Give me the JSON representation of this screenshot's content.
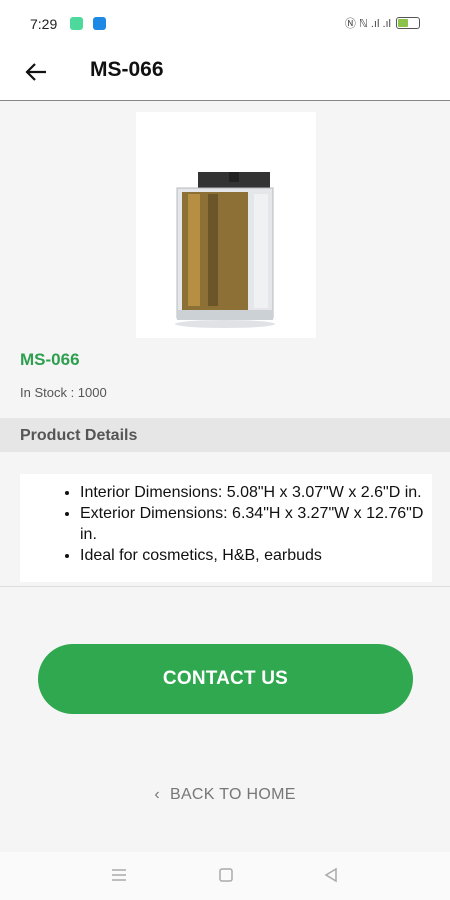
{
  "status_bar": {
    "time": "7:29",
    "right_text": "Ⓝ ℕ .ıl .ıl",
    "battery_level": 0.55,
    "colors": {
      "app1": "#4cd99b",
      "app2": "#1e88e5"
    }
  },
  "app_bar": {
    "back_icon": "arrow-left-icon",
    "title": "MS-066"
  },
  "product": {
    "name": "MS-066",
    "stock_label": "In Stock : 1000"
  },
  "details": {
    "header": "Product Details",
    "items": [
      "Interior Dimensions: 5.08\"H x 3.07\"W x 2.6\"D in.",
      "Exterior Dimensions: 6.34\"H x 3.27\"W x 12.76\"D in.",
      "Ideal for cosmetics, H&B, earbuds"
    ]
  },
  "actions": {
    "contact_label": "CONTACT US",
    "back_home_label": "BACK TO HOME",
    "accent_color": "#2fa84f"
  },
  "nav_bar": {
    "icons": [
      "menu-icon",
      "home-square-icon",
      "back-triangle-icon"
    ]
  }
}
